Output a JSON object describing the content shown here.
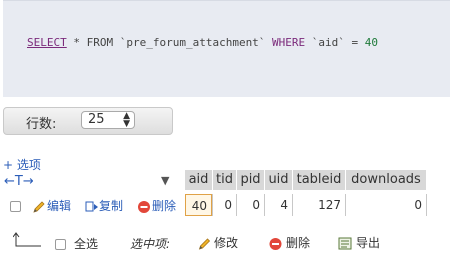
{
  "sql": {
    "select": "SELECT",
    "star_from": " * FROM ",
    "table": "`pre_forum_attachment`",
    "where": " WHERE ",
    "column": "`aid`",
    "eq": " = ",
    "value": "40"
  },
  "rows": {
    "label": "行数:",
    "value": "25"
  },
  "options_link": "+ 选项",
  "column_arrows": "←T→",
  "table": {
    "headers": [
      "aid",
      "tid",
      "pid",
      "uid",
      "tableid",
      "downloads"
    ],
    "row": [
      "40",
      "0",
      "0",
      "4",
      "127",
      "0"
    ]
  },
  "row_actions": {
    "edit": "编辑",
    "copy": "复制",
    "delete": "删除"
  },
  "bottom": {
    "select_all": "全选",
    "with_selected": "选中项:",
    "modify": "修改",
    "delete": "删除",
    "export": "导出"
  }
}
